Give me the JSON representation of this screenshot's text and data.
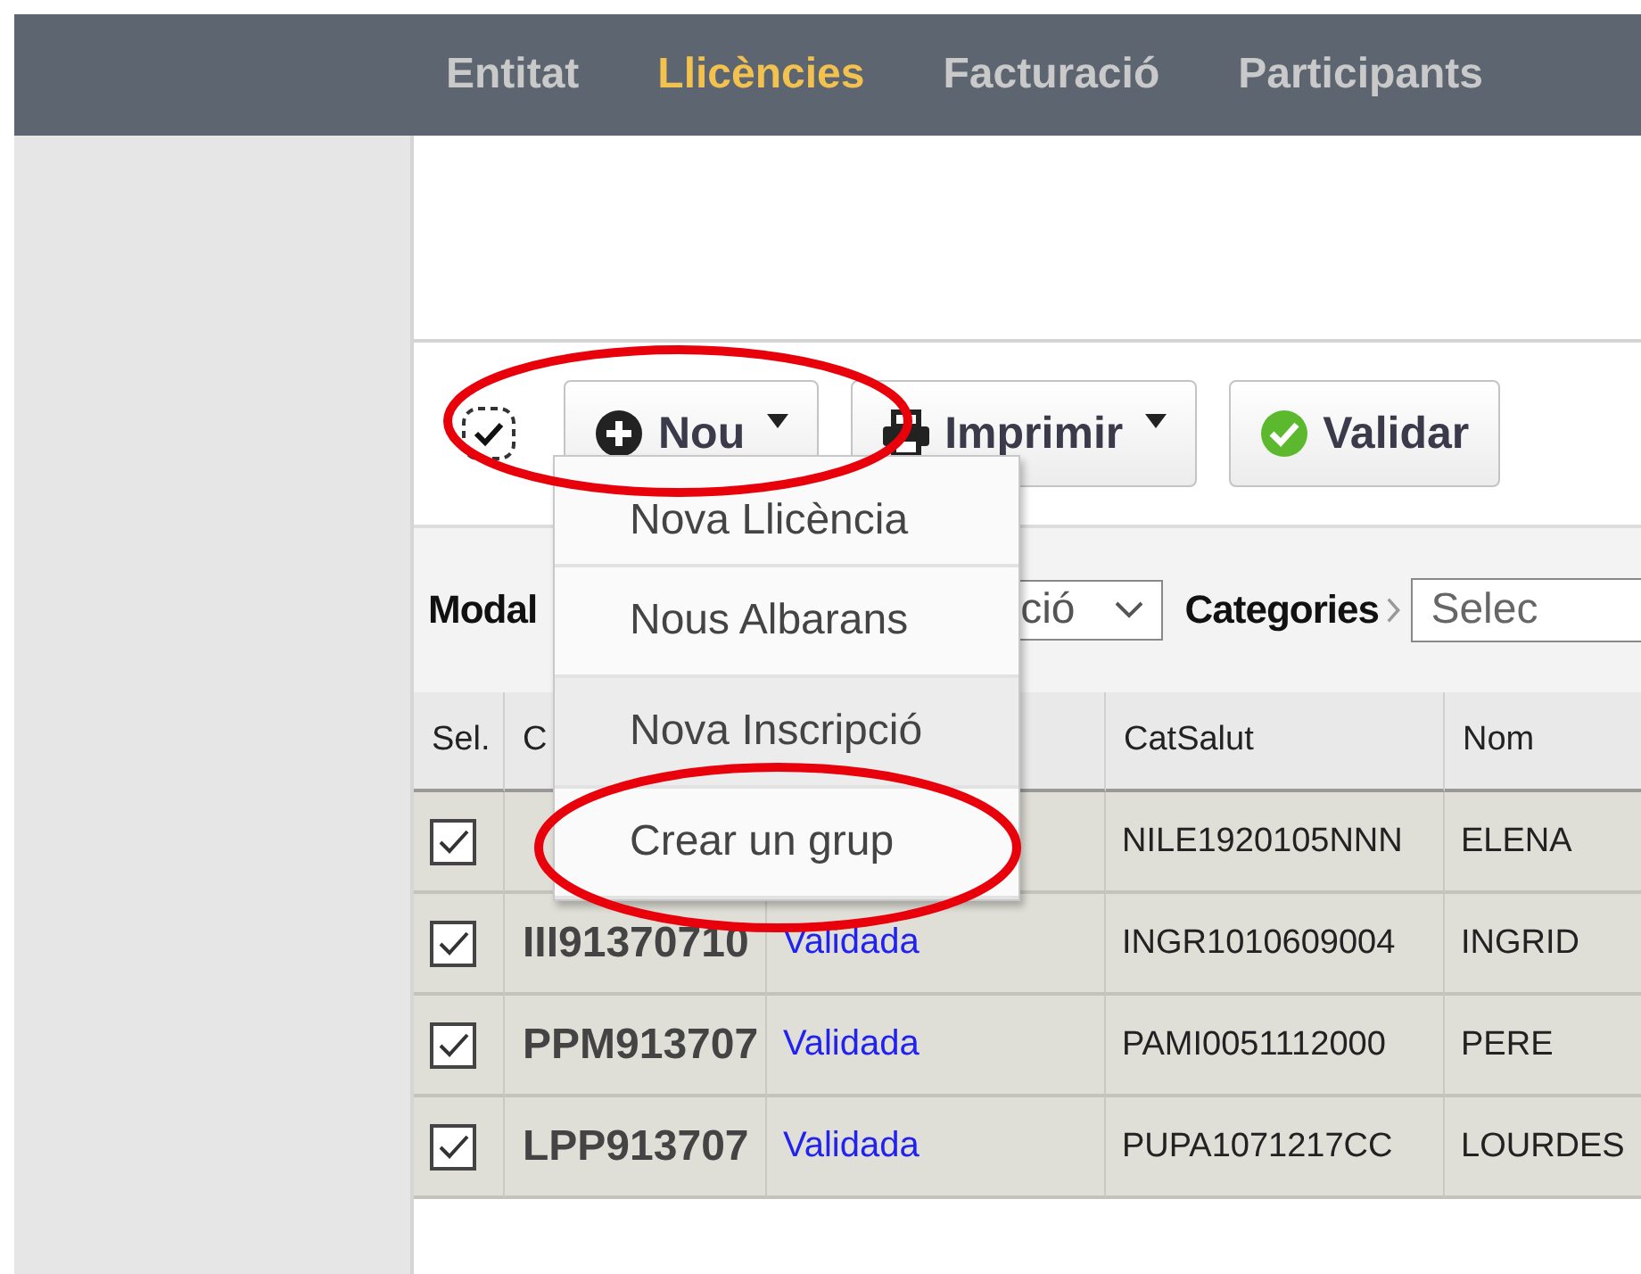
{
  "nav": {
    "items": [
      {
        "label": "Entitat",
        "selected": false
      },
      {
        "label": "Llicències",
        "selected": true
      },
      {
        "label": "Facturació",
        "selected": false
      },
      {
        "label": "Participants",
        "selected": false
      }
    ]
  },
  "toolbar": {
    "select_all": {
      "checked": true
    },
    "buttons": [
      {
        "kind": "plus",
        "label": "Nou",
        "caret": true
      },
      {
        "kind": "print",
        "label": "Imprimir",
        "caret": true
      },
      {
        "kind": "check",
        "label": "Validar",
        "caret": false
      }
    ]
  },
  "filters": {
    "modality_label": "Modal",
    "modality_value": "ció",
    "categories_label": "Categories",
    "categories_placeholder": "Selec"
  },
  "table": {
    "columns": [
      {
        "label": "Sel."
      },
      {
        "label": "C"
      },
      {},
      {
        "label": "CatSalut"
      },
      {
        "label": "Nom"
      }
    ],
    "rows": [
      {
        "checked": true,
        "catsalut": "NILE1920105NNN",
        "nom": "ELENA"
      },
      {
        "checked": true,
        "code": "III91370710",
        "status": "Validada",
        "catsalut": "INGR1010609004",
        "nom": "INGRID"
      },
      {
        "checked": true,
        "code": "PPM913707",
        "status": "Validada",
        "catsalut": "PAMI0051112000",
        "nom": "PERE"
      },
      {
        "checked": true,
        "code": "LPP913707",
        "status": "Validada",
        "catsalut": "PUPA1071217CC",
        "nom": "LOURDES"
      }
    ]
  },
  "dropdown_menu": {
    "items": [
      {
        "label": "Nova Llicència",
        "selected": false
      },
      {
        "label": "Nous Albarans",
        "selected": false
      },
      {
        "label": "Nova Inscripció",
        "selected": true
      },
      {
        "label": "Crear un grup",
        "selected": false
      }
    ]
  }
}
